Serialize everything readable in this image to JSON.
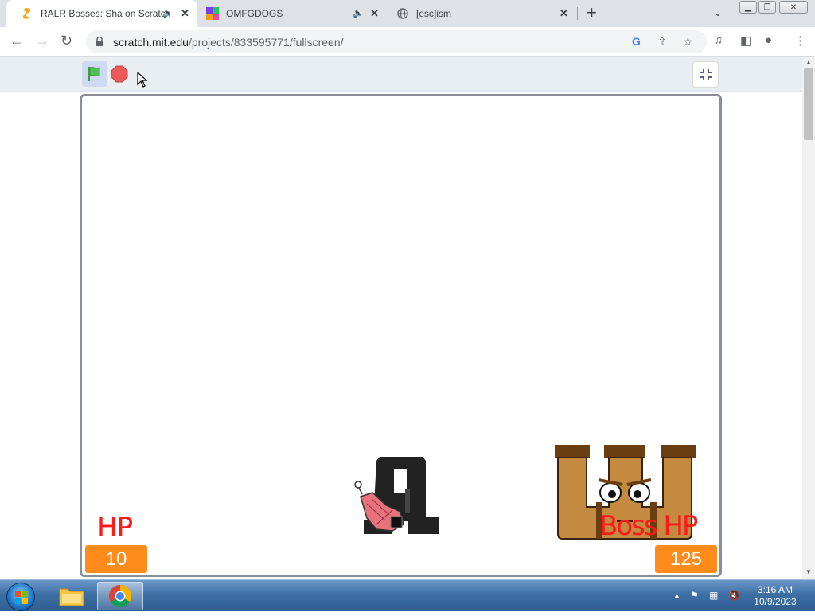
{
  "browser": {
    "tabs": [
      {
        "title": "RALR Bosses: Sha on Scratch",
        "active": true,
        "audio": true
      },
      {
        "title": "OMFGDOGS",
        "active": false,
        "audio": true
      },
      {
        "title": "[esc]ism",
        "active": false,
        "audio": false
      }
    ],
    "new_tab": "+",
    "tab_search": "⌄",
    "url": {
      "host": "scratch.mit.edu",
      "path": "/projects/833595771/fullscreen/"
    }
  },
  "scratch": {
    "player_hp_label": "HP",
    "player_hp_value": "10",
    "boss_hp_label": "Boss HP",
    "boss_hp_value": "125"
  },
  "taskbar": {
    "time": "3:16 AM",
    "date": "10/9/2023"
  },
  "colors": {
    "hp_text": "#ff1a1a",
    "hp_box": "#ff8c1a",
    "flag_green": "#4cbf56",
    "stop_red": "#ec5959"
  }
}
